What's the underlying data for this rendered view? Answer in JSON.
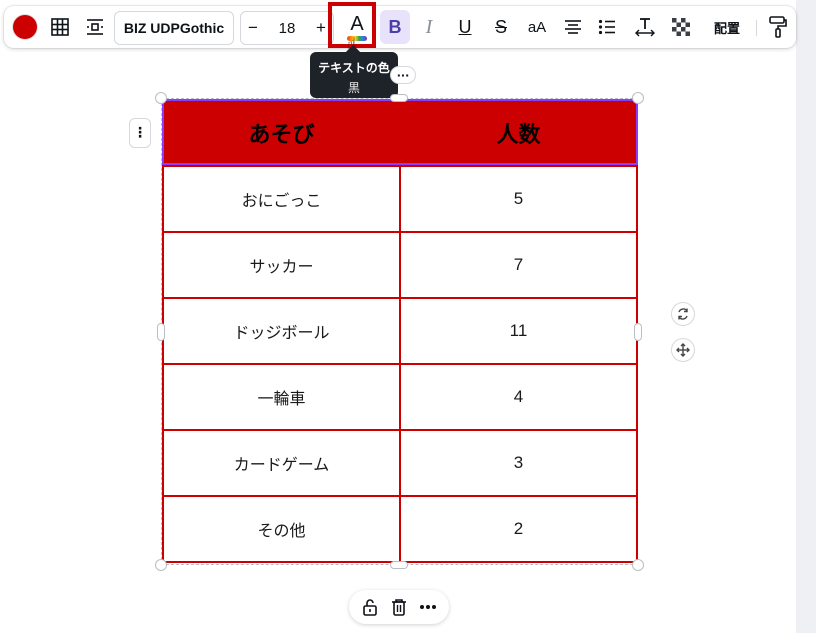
{
  "toolbar": {
    "fill_color": "#cc0000",
    "font_name": "BIZ UDPGothic",
    "font_size": "18",
    "size_minus": "−",
    "size_plus": "+",
    "text_color_glyph": "A",
    "bold_glyph": "B",
    "italic_glyph": "I",
    "underline_glyph": "U",
    "strike_glyph": "S",
    "case_glyph": "aA",
    "position_label": "配置",
    "icons": [
      "table-grid-icon",
      "spacing-icon",
      "align-center-icon",
      "bullet-list-icon",
      "letter-spacing-icon",
      "transparency-icon",
      "paint-roller-icon"
    ]
  },
  "tooltip": {
    "title": "テキストの色",
    "value": "黒"
  },
  "table": {
    "headers": [
      "あそび",
      "人数"
    ],
    "rows": [
      [
        "おにごっこ",
        "5"
      ],
      [
        "サッカー",
        "7"
      ],
      [
        "ドッジボール",
        "11"
      ],
      [
        "一輪車",
        "4"
      ],
      [
        "カードゲーム",
        "3"
      ],
      [
        "その他",
        "2"
      ]
    ],
    "header_fill": "#cc0000",
    "border_color": "#cc0000"
  },
  "accent_color": "#8b3dff"
}
